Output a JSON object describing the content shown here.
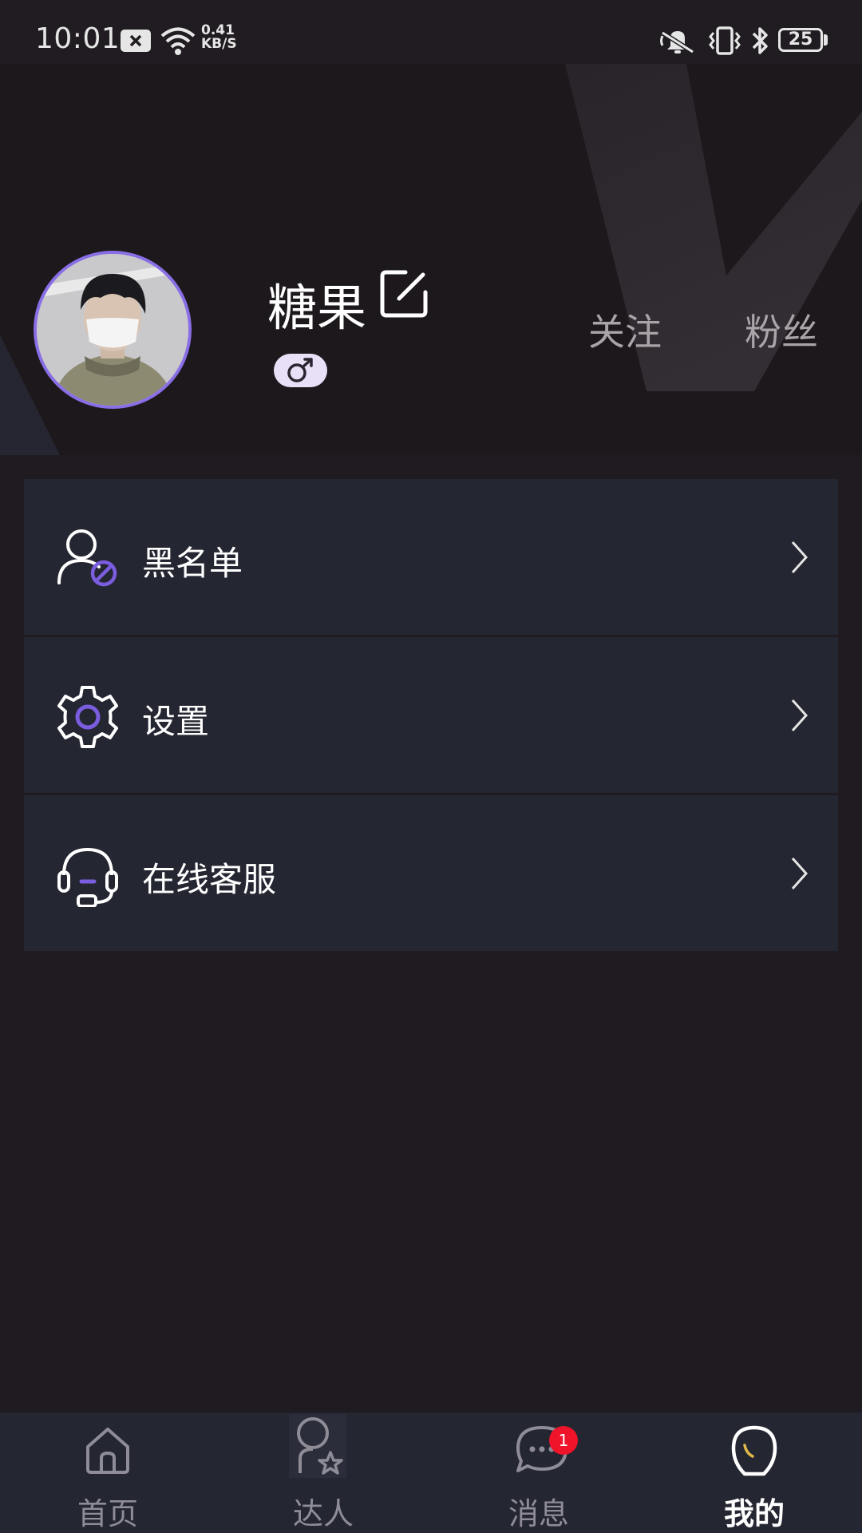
{
  "status_bar": {
    "time": "10:01",
    "net_speed_value": "0.41",
    "net_speed_unit": "KB/S",
    "battery": "25"
  },
  "profile": {
    "username": "糖果",
    "gender_symbol": "♂",
    "follow_label": "关注",
    "fans_label": "粉丝"
  },
  "menu": [
    {
      "label": "黑名单",
      "icon": "user-block-icon"
    },
    {
      "label": "设置",
      "icon": "gear-icon"
    },
    {
      "label": "在线客服",
      "icon": "headset-icon"
    }
  ],
  "nav": {
    "items": [
      {
        "label": "首页",
        "icon": "home-icon"
      },
      {
        "label": "达人",
        "icon": "user-star-icon"
      },
      {
        "label": "消息",
        "icon": "chat-icon"
      },
      {
        "label": "我的",
        "icon": "me-icon"
      }
    ],
    "active_index": 3,
    "message_badge": "1"
  },
  "colors": {
    "accent": "#7b5de0",
    "background": "#201b20",
    "card": "#242632",
    "badge": "#f0142a"
  }
}
